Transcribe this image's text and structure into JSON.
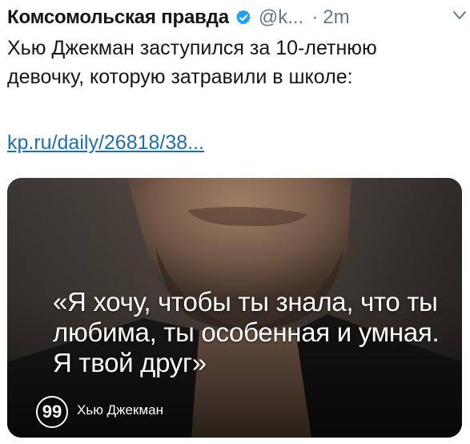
{
  "tweet": {
    "author_name": "Комсомольская правда",
    "handle": "@k...",
    "separator": "·",
    "time": "2m",
    "text": "Хью Джекман заступился за 10-летнюю девочку, которую затравили в школе:",
    "link": "kp.ru/daily/26818/38..."
  },
  "media": {
    "quote": "«Я хочу, чтобы ты знала, что ты любима, ты особенная и умная. Я твой друг»",
    "badge": "99",
    "attribution": "Хью Джекман"
  },
  "colors": {
    "verified": "#1da1f2",
    "link": "#1b6fb3",
    "muted": "#657786"
  },
  "icons": {
    "verified": "verified-badge-icon",
    "menu": "chevron-down-icon",
    "quote": "quote-icon"
  }
}
